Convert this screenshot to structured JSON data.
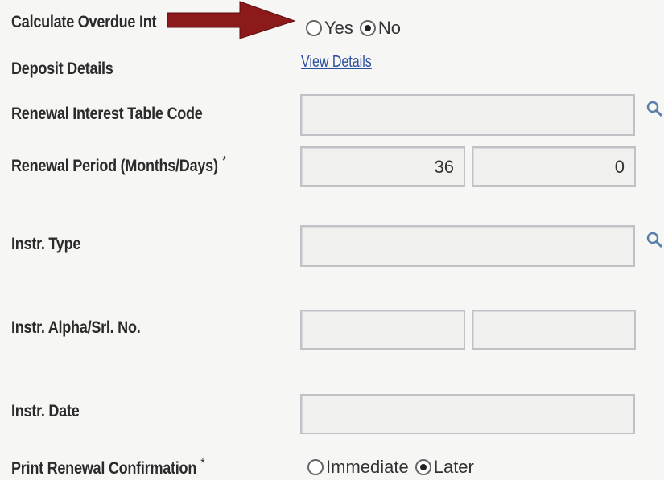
{
  "form": {
    "overdue": {
      "label": "Calculate Overdue Int",
      "options": [
        "Yes",
        "No"
      ],
      "selected": "No"
    },
    "deposit": {
      "label": "Deposit Details",
      "link": "View Details"
    },
    "renewal_interest": {
      "label": "Renewal Interest Table Code",
      "value": ""
    },
    "renewal_period": {
      "label": "Renewal Period (Months/Days)",
      "required": "*",
      "months": "36",
      "days": "0"
    },
    "instr_type": {
      "label": "Instr. Type",
      "value": ""
    },
    "instr_alpha": {
      "label": "Instr. Alpha/Srl. No.",
      "alpha": "",
      "serial": ""
    },
    "instr_date": {
      "label": "Instr. Date",
      "value": ""
    },
    "print_renewal": {
      "label": "Print Renewal Confirmation",
      "required": "*",
      "options": [
        "Immediate",
        "Later"
      ],
      "selected": "Later"
    }
  },
  "icons": {
    "lookup": "magnifier-icon",
    "arrow": "red-arrow-icon"
  },
  "colors": {
    "arrow": "#8c1a1a",
    "link": "#2c4fa0",
    "field_border": "#bfc3c6"
  }
}
